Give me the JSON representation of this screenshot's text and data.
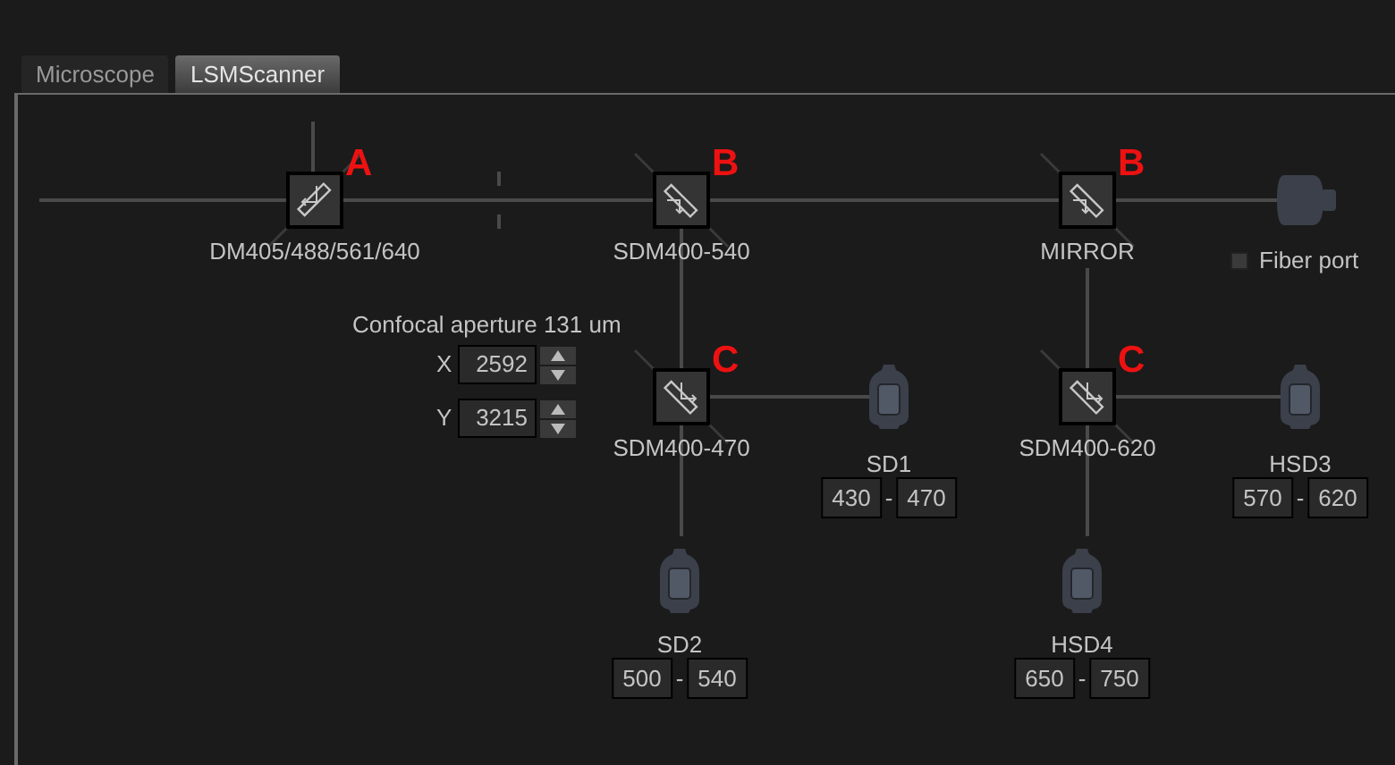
{
  "tabs": [
    {
      "label": "Microscope",
      "selected": false
    },
    {
      "label": "LSMScanner",
      "selected": true
    }
  ],
  "mirrors": [
    {
      "label": "DM405/488/561/640",
      "marker": "A"
    },
    {
      "label": "SDM400-540",
      "marker": "B"
    },
    {
      "label": "MIRROR",
      "marker": "B"
    },
    {
      "label": "SDM400-470",
      "marker": "C"
    },
    {
      "label": "SDM400-620",
      "marker": "C"
    }
  ],
  "fiber_port": {
    "label": "Fiber port",
    "checked": false
  },
  "aperture": {
    "label": "Confocal aperture 131 um",
    "fields": [
      {
        "axis": "X",
        "value": "2592"
      },
      {
        "axis": "Y",
        "value": "3215"
      }
    ]
  },
  "detectors": [
    {
      "label": "SD1",
      "range": [
        "430",
        "-",
        "470"
      ]
    },
    {
      "label": "HSD3",
      "range": [
        "570",
        "-",
        "620"
      ]
    },
    {
      "label": "SD2",
      "range": [
        "500",
        "-",
        "540"
      ]
    },
    {
      "label": "HSD4",
      "range": [
        "650",
        "-",
        "750"
      ]
    }
  ]
}
